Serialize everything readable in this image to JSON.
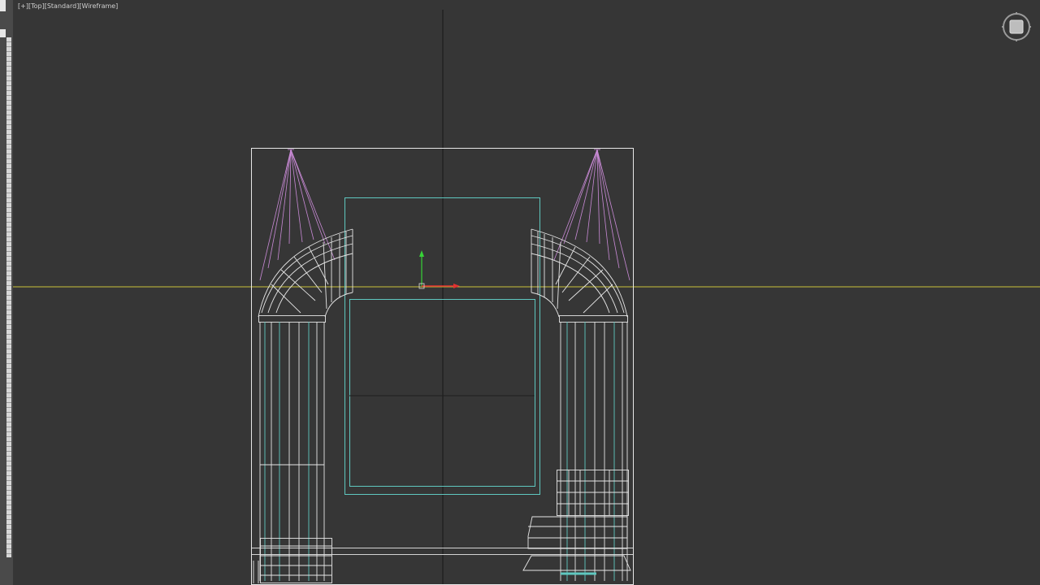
{
  "viewport": {
    "label_plus": "[+]",
    "label_view": "[Top]",
    "label_shading_preset": "[Standard]",
    "label_shading_mode": "[Wireframe]"
  },
  "icons": {
    "viewcube": "viewcube-icon",
    "transform_gizmo": "move-gizmo-icon"
  },
  "colors": {
    "background": "#353535",
    "grid_axis": "#1c1c1c",
    "horizon_line": "#c9c23a",
    "selection_box": "#e8e8e8",
    "wire_white": "#e6e6e6",
    "wire_cyan": "#5fc8c0",
    "wire_magenta": "#c98ad6",
    "gizmo_y": "#37d437",
    "gizmo_x": "#e23030"
  }
}
